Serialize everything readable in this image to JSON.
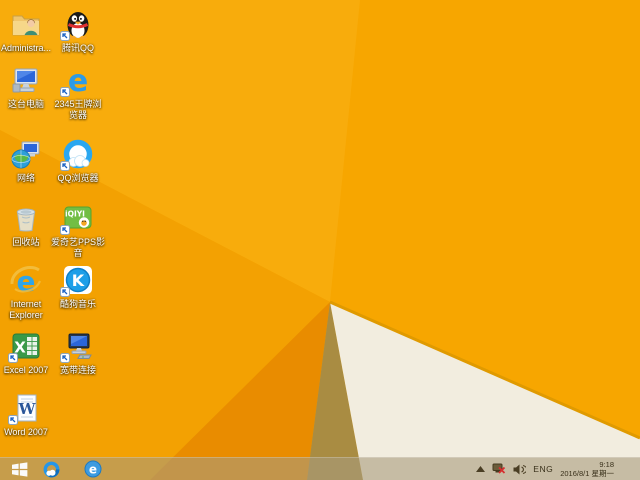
{
  "wallpaper": {
    "colors": {
      "base": "#F7A600",
      "facet_light": "#F8AC0C",
      "facet_left": "#F3A102",
      "facet_dark": "#E98C00",
      "facet_olive": "#A98C42",
      "facet_white": "#F2EDDF",
      "facet_edge": "#E09A00"
    }
  },
  "desktop": {
    "icons": [
      {
        "id": "administrator",
        "label": "Administra...",
        "icon": "user-folder-icon",
        "shortcut": false
      },
      {
        "id": "tencent-qq",
        "label": "腾讯QQ",
        "icon": "qq-penguin-icon",
        "shortcut": true
      },
      {
        "id": "this-pc",
        "label": "这台电脑",
        "icon": "computer-icon",
        "shortcut": false
      },
      {
        "id": "2345-browser",
        "label": "2345王牌浏览器",
        "lines": [
          "2345王牌浏",
          "览器"
        ],
        "icon": "blue-e-browser-icon",
        "shortcut": true
      },
      {
        "id": "network",
        "label": "网络",
        "icon": "network-globe-icon",
        "shortcut": false
      },
      {
        "id": "qq-browser",
        "label": "QQ浏览器",
        "icon": "qq-browser-icon",
        "shortcut": true
      },
      {
        "id": "recycle-bin",
        "label": "回收站",
        "icon": "recycle-bin-icon",
        "shortcut": false
      },
      {
        "id": "iqiyi-pps",
        "label": "爱奇艺PPS影音",
        "lines": [
          "爱奇艺PPS影",
          "音"
        ],
        "icon": "iqiyi-icon",
        "shortcut": true
      },
      {
        "id": "internet-explorer",
        "label": "Internet Explorer",
        "lines": [
          "Internet",
          "Explorer"
        ],
        "icon": "ie-icon",
        "shortcut": false
      },
      {
        "id": "kugou-music",
        "label": "酷狗音乐",
        "icon": "kugou-icon",
        "shortcut": true
      },
      {
        "id": "excel-2007",
        "label": "Excel 2007",
        "icon": "excel-icon",
        "shortcut": true
      },
      {
        "id": "broadband",
        "label": "宽带连接",
        "icon": "broadband-icon",
        "shortcut": true
      },
      {
        "id": "word-2007",
        "label": "Word 2007",
        "icon": "word-icon",
        "shortcut": true
      }
    ]
  },
  "taskbar": {
    "overlay_color": "rgba(168,155,125,0.60)",
    "start_icon": "windows-logo",
    "pinned": [
      {
        "id": "qq-browser",
        "icon": "qq-browser-icon"
      },
      {
        "id": "internet-explorer",
        "icon": "ie-icon"
      }
    ],
    "tray": {
      "hidden_icons_icon": "chevron-up",
      "network_icon": "network-disconnected",
      "volume_icon": "speaker",
      "language": "ENG",
      "time": "9:18",
      "date": "2016/8/1 星期一"
    }
  }
}
